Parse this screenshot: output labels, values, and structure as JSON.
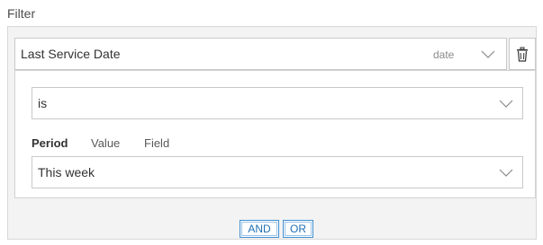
{
  "filter": {
    "title": "Filter"
  },
  "field": {
    "label": "Last Service Date",
    "type": "date"
  },
  "operator": {
    "value": "is"
  },
  "tabs": [
    {
      "label": "Period",
      "active": true
    },
    {
      "label": "Value",
      "active": false
    },
    {
      "label": "Field",
      "active": false
    }
  ],
  "period": {
    "value": "This week"
  },
  "logic": {
    "and_label": "AND",
    "or_label": "OR"
  },
  "colors": {
    "accent": "#1f6fb5",
    "panel_bg": "#f3f3f3",
    "border": "#c9c9c9"
  },
  "icons": {
    "delete": "trash-icon",
    "dropdown": "chevron-down-icon"
  }
}
